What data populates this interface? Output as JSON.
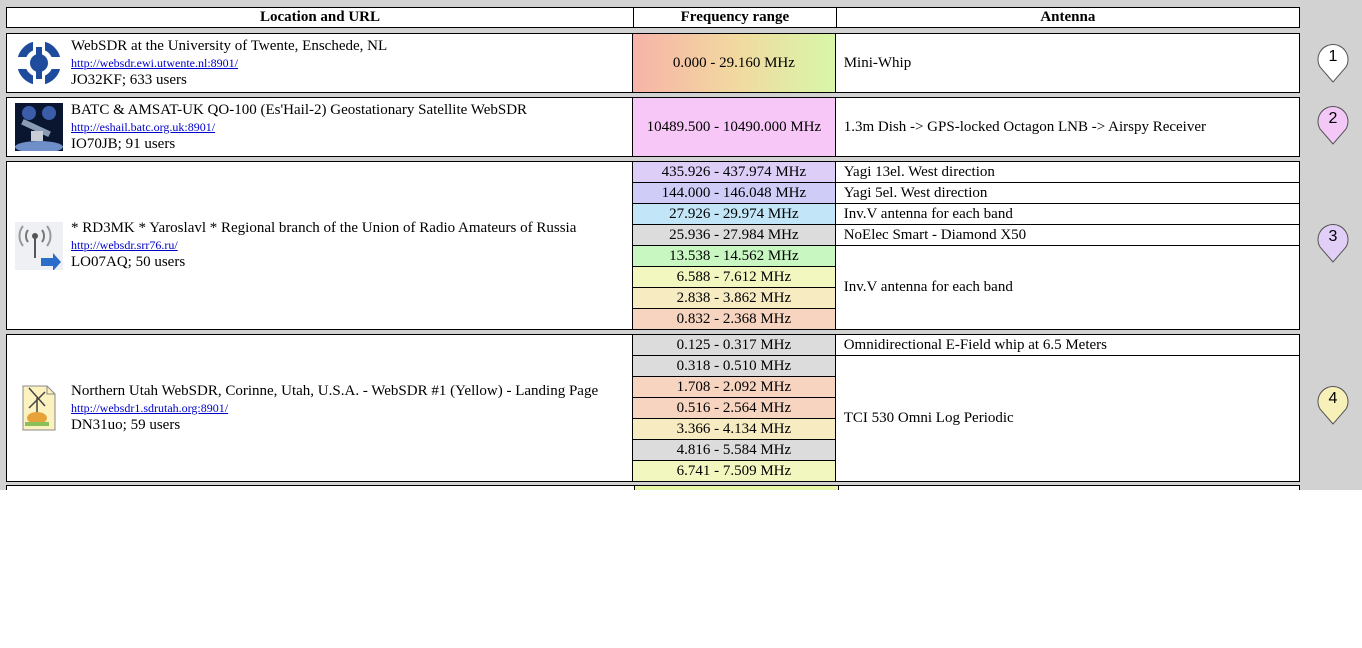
{
  "header": {
    "location": "Location and URL",
    "frequency": "Frequency range",
    "antenna": "Antenna"
  },
  "entries": [
    {
      "name": "WebSDR at the University of Twente, Enschede, NL",
      "url": "http://websdr.ewi.utwente.nl:8901/",
      "meta": "JO32KF; 633 users",
      "icon": "utwente-logo-icon",
      "marker": "1",
      "marker_color": "#ffffff",
      "freqs": [
        {
          "text": "0.000 - 29.160 MHz",
          "color": "gradient-red-green"
        }
      ],
      "antennas": [
        "Mini-Whip"
      ]
    },
    {
      "name": "BATC & AMSAT-UK QO-100 (Es'Hail-2) Geostationary Satellite WebSDR",
      "url": "http://eshail.batc.org.uk:8901/",
      "meta": "IO70JB; 91 users",
      "icon": "satellite-image-icon",
      "marker": "2",
      "marker_color": "#f3c8f7",
      "freqs": [
        {
          "text": "10489.500 - 10490.000 MHz",
          "color": "#f7c8f7"
        }
      ],
      "antennas": [
        "1.3m Dish -> GPS-locked Octagon LNB -> Airspy Receiver"
      ]
    },
    {
      "name": "* RD3MK * Yaroslavl * Regional branch of the Union of Radio Amateurs of Russia",
      "url": "http://websdr.srr76.ru/",
      "meta": "LO07AQ; 50 users",
      "icon": "radio-tower-icon",
      "marker": "3",
      "marker_color": "#e2cff7",
      "freqs": [
        {
          "text": "435.926 - 437.974 MHz",
          "color": "#dccef7"
        },
        {
          "text": "144.000 - 146.048 MHz",
          "color": "#cfcdf7"
        },
        {
          "text": "27.926 - 29.974 MHz",
          "color": "#c2e6f7"
        },
        {
          "text": "25.936 - 27.984 MHz",
          "color": "#dcdcdc"
        },
        {
          "text": "13.538 - 14.562 MHz",
          "color": "#c8f7c2"
        },
        {
          "text": "6.588 - 7.612 MHz",
          "color": "#f2f7c0"
        },
        {
          "text": "2.838 - 3.862 MHz",
          "color": "#f7ebc2"
        },
        {
          "text": "0.832 - 2.368 MHz",
          "color": "#f7d4c0"
        }
      ],
      "antennas": [
        "Yagi 13el. West direction",
        "Yagi 5el. West direction",
        "Inv.V antenna for each band",
        "NoElec Smart - Diamond X50",
        "Inv.V antenna for each band"
      ]
    },
    {
      "name": "Northern Utah WebSDR, Corinne, Utah, U.S.A. - WebSDR #1 (Yellow) - Landing Page",
      "url": "http://websdr1.sdrutah.org:8901/",
      "meta": "DN31uo; 59 users",
      "icon": "antenna-document-icon",
      "marker": "4",
      "marker_color": "#f7f0b8",
      "freqs": [
        {
          "text": "0.125 - 0.317 MHz",
          "color": "#dcdcdc"
        },
        {
          "text": "0.318 - 0.510 MHz",
          "color": "#dcdcdc"
        },
        {
          "text": "1.708 - 2.092 MHz",
          "color": "#f7d4c0"
        },
        {
          "text": "0.516 - 2.564 MHz",
          "color": "#f7d4c0"
        },
        {
          "text": "3.366 - 4.134 MHz",
          "color": "#f7ebc2"
        },
        {
          "text": "4.816 - 5.584 MHz",
          "color": "#dcdcdc"
        },
        {
          "text": "6.741 - 7.509 MHz",
          "color": "#f2f7c0"
        }
      ],
      "antennas": [
        "Omnidirectional E-Field whip at 6.5 Meters",
        "TCI 530 Omni Log Periodic"
      ]
    }
  ]
}
